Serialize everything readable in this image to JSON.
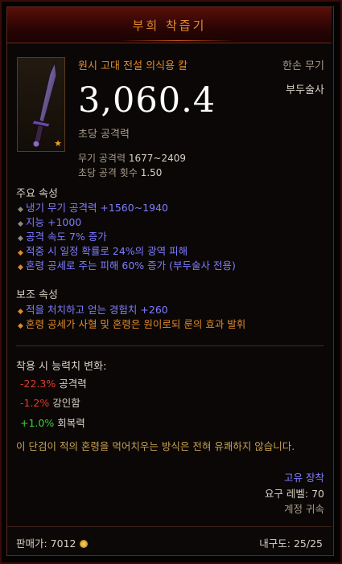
{
  "title": "부희 착즙기",
  "item": {
    "name": "원시 고대 전설 의식용 칼",
    "type": "한손 무기",
    "class": "부두술사",
    "dps": "3,060.4",
    "dps_label": "초당 공격력",
    "damage_label": "무기 공격력",
    "damage_value": "1677~2409",
    "speed_label": "초당 공격 횟수",
    "speed_value": "1.50",
    "icon": "ceremonial-dagger-icon",
    "ancient_marker": "star-icon"
  },
  "primary": {
    "title": "주요 속성",
    "lines": [
      "냉기 무기 공격력 +1560~1940",
      "지능 +1000",
      "공격 속도 7% 증가",
      "적중 시 일정 확률로 24%의 광역 피해",
      "혼령 공세로 주는 피해 60% 증가 (부두술사 전용)"
    ]
  },
  "secondary": {
    "title": "보조 속성",
    "lines": [
      "적을 처치하고 얻는 경험치 +260",
      "혼령 공세가 사혈 및 혼령은 원이로되 룬의 효과 발휘"
    ]
  },
  "changes": {
    "title": "착용 시 능력치 변화:",
    "items": [
      {
        "value": "-22.3%",
        "label": "공격력"
      },
      {
        "value": "-1.2%",
        "label": "강인함"
      },
      {
        "value": "+1.0%",
        "label": "회복력"
      }
    ]
  },
  "flavor": "이 단검이 적의 혼령을 먹어치우는 방식은 전혀 유쾌하지 않습니다.",
  "rarity": "고유 장착",
  "required_level": "요구 레벨: 70",
  "bound": "계정 귀속",
  "footer": {
    "price": "판매가: 7012",
    "durability": "내구도: 25/25"
  },
  "colors": {
    "legendary": "#e08a2c",
    "magic": "#7f7dff",
    "negative": "#e23a2a",
    "positive": "#3ed13e",
    "flavor": "#c8a252"
  }
}
